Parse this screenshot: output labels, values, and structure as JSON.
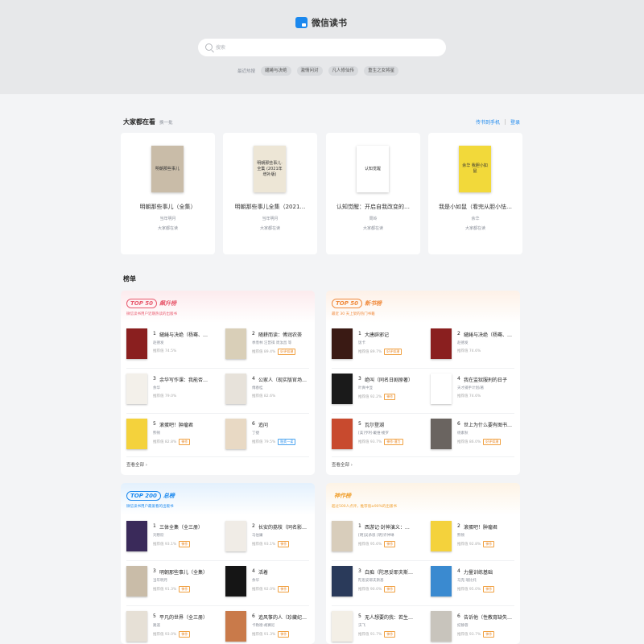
{
  "app": {
    "title": "微信读书"
  },
  "search": {
    "placeholder": "搜索"
  },
  "hot": {
    "label": "最近热搜",
    "tags": [
      "繾綣与决绝",
      "激情问对",
      "凡人修仙传",
      "重生之女将星"
    ]
  },
  "recommend": {
    "title": "大家都在看",
    "refresh_label": "换一批",
    "send_to_phone": "传书到手机",
    "login": "登录",
    "books": [
      {
        "title": "明朝那些事儿（全集）",
        "author": "当年明月",
        "reading": "大家都在读",
        "cover_color": "#c9bca8",
        "cover_text": "明朝那些事儿"
      },
      {
        "title": "明朝那些事儿全集（2021…",
        "author": "当年明月",
        "reading": "大家都在读",
        "cover_color": "#ede6d6",
        "cover_text": "明朝那些事儿·全集 (2021年增补版)"
      },
      {
        "title": "认知觉醒：开启自我改变的…",
        "author": "周岭",
        "reading": "大家都在读",
        "cover_color": "#ffffff",
        "cover_text": "认知觉醒"
      },
      {
        "title": "我是小如鼠（看完从胆小怯…",
        "author": "余华",
        "reading": "大家都在读",
        "cover_color": "#f2d93a",
        "cover_text": "余华 我胆小如鼠"
      }
    ]
  },
  "rankings": {
    "title": "榜单",
    "view_all": "查看全部 ›",
    "cards": [
      {
        "top": "TOP 50",
        "name": "飙升榜",
        "accent": "#e85a6e",
        "desc": "微信读书用户近期热读的出版书",
        "items": [
          {
            "num": "1",
            "title": "繾綣与决绝（杨骞、…",
            "author": "赵德发",
            "rec": "推荐值 74.5%",
            "tag": "",
            "cover": "#8a1f1f"
          },
          {
            "num": "2",
            "title": "随耕而读：傅润农荼",
            "author": "季羡林 汪曾祺 周汝昌 等",
            "rec": "推荐值 89.4%",
            "tag": "好评如潮",
            "cover": "#d9cfb8"
          },
          {
            "num": "3",
            "title": "余华写作课：我能否…",
            "author": "余华",
            "rec": "推荐值 79.0%",
            "tag": "",
            "cover": "#f3f0ea"
          },
          {
            "num": "4",
            "title": "公家人（现实版官场…",
            "author": "傅春桂",
            "rec": "推荐值 82.6%",
            "tag": "",
            "cover": "#e7e2da"
          },
          {
            "num": "5",
            "title": "滚蛋吧！肿瘤君",
            "author": "熊顿",
            "rec": "推荐值 82.8%",
            "tag": "神作",
            "cover": "#f4d23c"
          },
          {
            "num": "6",
            "title": "追问",
            "author": "丁捷",
            "rec": "推荐值 79.5%",
            "tag": "脍炙一读",
            "tag_blue": true,
            "cover": "#e8d9c4"
          }
        ]
      },
      {
        "top": "TOP 50",
        "name": "新书榜",
        "accent": "#f08a3c",
        "desc": "最近 30 天上架的热门书籍",
        "items": [
          {
            "num": "1",
            "title": "大唐辟邪记",
            "author": "饭卡",
            "rec": "推荐值 89.7%",
            "tag": "好评如潮",
            "cover": "#3a1a14"
          },
          {
            "num": "2",
            "title": "繾綣与决绝（杨骞、…",
            "author": "赵德发",
            "rec": "推荐值 74.6%",
            "tag": "",
            "cover": "#8a1f1f"
          },
          {
            "num": "3",
            "title": "绝叫（同名日剧原著）",
            "author": "叶真中显",
            "rec": "推荐值 92.2%",
            "tag": "神作",
            "cover": "#1a1a1a"
          },
          {
            "num": "4",
            "title": "我在监狱服刑的日子",
            "author": "天才捕手计划/著",
            "rec": "推荐值 74.6%",
            "tag": "",
            "cover": "#ffffff"
          },
          {
            "num": "5",
            "title": "瓦尔登湖",
            "author": "[美]亨利·戴维·梭罗",
            "rec": "推荐值 93.7%",
            "tag": "神作·潜力",
            "cover": "#c84a2e"
          },
          {
            "num": "6",
            "title": "世上为什么要有图书…",
            "author": "杨素秋",
            "rec": "推荐值 86.0%",
            "tag": "好评如潮",
            "cover": "#6a6460"
          }
        ]
      },
      {
        "top": "TOP 200",
        "name": "总榜",
        "accent": "#1b88ee",
        "desc": "微信读书用户最爱看的出版书",
        "items": [
          {
            "num": "1",
            "title": "三体全集（全三册）",
            "author": "刘慈欣",
            "rec": "推荐值 93.1%",
            "tag": "神作",
            "cover": "#3a2a5a"
          },
          {
            "num": "2",
            "title": "长安的荔枝（同名影…",
            "author": "马伯庸",
            "rec": "推荐值 93.1%",
            "tag": "神作",
            "cover": "#f0ece6"
          },
          {
            "num": "3",
            "title": "明朝那些事儿（全集）",
            "author": "当年明月",
            "rec": "推荐值 91.3%",
            "tag": "神作",
            "cover": "#c9bca8"
          },
          {
            "num": "4",
            "title": "活着",
            "author": "余华",
            "rec": "推荐值 92.0%",
            "tag": "神作",
            "cover": "#151515"
          },
          {
            "num": "5",
            "title": "平凡的世界（全三册）",
            "author": "路遥",
            "rec": "推荐值 93.0%",
            "tag": "神作",
            "cover": "#e6e0d6"
          },
          {
            "num": "6",
            "title": "追风筝的人（珍藏纪…",
            "author": "卡勒德·胡赛尼",
            "rec": "推荐值 91.3%",
            "tag": "神作",
            "cover": "#c97a4a"
          }
        ]
      },
      {
        "top": "",
        "name": "神作榜",
        "accent": "#f0a030",
        "desc": "超过500人点评，推荐值≥90%的出版书",
        "items": [
          {
            "num": "1",
            "title": "西游记·封神演义：…",
            "author": "[明]吴承恩 [明]许仲琳",
            "rec": "推荐值 95.6%",
            "tag": "神作",
            "cover": "#d8cdbb"
          },
          {
            "num": "2",
            "title": "滚蛋吧！肿瘤君",
            "author": "熊顿",
            "rec": "推荐值 92.8%",
            "tag": "神作",
            "cover": "#f4d23c"
          },
          {
            "num": "3",
            "title": "白痴（陀思妥耶夫斯…",
            "author": "陀思妥耶夫斯基",
            "rec": "推荐值 90.0%",
            "tag": "神作",
            "cover": "#2a3a5a"
          },
          {
            "num": "4",
            "title": "力量训练基础",
            "author": "马克·瑞比托",
            "rec": "推荐值 95.0%",
            "tag": "神作",
            "cover": "#3a8ad0"
          },
          {
            "num": "5",
            "title": "无人想要的我：若生…",
            "author": "沃飞",
            "rec": "推荐值 91.7%",
            "tag": "神作",
            "cover": "#f3efe6"
          },
          {
            "num": "6",
            "title": "告诉他（性教育缺失…",
            "author": "纪静蓉",
            "rec": "推荐值 93.7%",
            "tag": "神作",
            "cover": "#c8c4bc"
          }
        ]
      }
    ]
  }
}
